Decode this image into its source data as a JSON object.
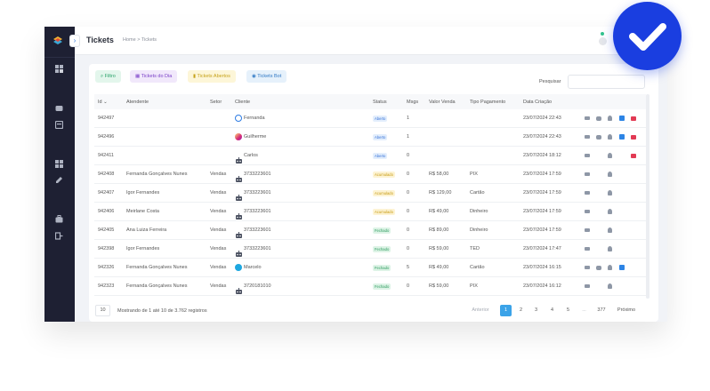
{
  "header": {
    "title": "Tickets",
    "breadcrumb": "Home  >  Tickets"
  },
  "filters": {
    "filtro": "Filtro",
    "tickets_dia": "Tickets do Dia",
    "tickets_abertos": "Tickets Abertos",
    "tickets_bot": "Tickets Bot"
  },
  "search": {
    "label": "Pesquisar",
    "value": ""
  },
  "table": {
    "columns": {
      "id": "Id",
      "atendente": "Atendente",
      "setor": "Setor",
      "cliente": "Cliente",
      "status": "Status",
      "msgs": "Msgs",
      "valor": "Valor Venda",
      "pagamento": "Tipo Pagamento",
      "data": "Data Criação"
    },
    "rows": [
      {
        "id": "942497",
        "atendente": "",
        "setor": "",
        "cliente": "Fernanda",
        "channel": "blue-ring",
        "status": "Aberto",
        "status_type": "aberto",
        "msgs": "1",
        "valor": "",
        "pagamento": "",
        "data": "23/07/2024 22:43",
        "actions": [
          "mail",
          "chat",
          "user",
          "blue",
          "red"
        ]
      },
      {
        "id": "942496",
        "atendente": "",
        "setor": "",
        "cliente": "Guilherme",
        "channel": "instagram",
        "status": "Aberto",
        "status_type": "aberto",
        "msgs": "1",
        "valor": "",
        "pagamento": "",
        "data": "23/07/2024 22:43",
        "actions": [
          "mail",
          "chat",
          "user",
          "blue",
          "red"
        ]
      },
      {
        "id": "942411",
        "atendente": "",
        "setor": "",
        "cliente": "Carlos",
        "channel": "robot",
        "status": "Aberto",
        "status_type": "aberto",
        "msgs": "0",
        "valor": "",
        "pagamento": "",
        "data": "23/07/2024 18:12",
        "actions": [
          "mail",
          "user",
          "red"
        ]
      },
      {
        "id": "942408",
        "atendente": "Fernanda Gonçalves Nunes",
        "setor": "Vendas",
        "cliente": "3733223601",
        "channel": "robot",
        "status": "Acumulado",
        "status_type": "acumulado",
        "msgs": "0",
        "valor": "R$ 58,00",
        "pagamento": "PIX",
        "data": "23/07/2024 17:59",
        "actions": [
          "mail",
          "user"
        ]
      },
      {
        "id": "942407",
        "atendente": "Igor Fernandes",
        "setor": "Vendas",
        "cliente": "3733223601",
        "channel": "robot",
        "status": "Acumulado",
        "status_type": "acumulado",
        "msgs": "0",
        "valor": "R$ 129,00",
        "pagamento": "Cartão",
        "data": "23/07/2024 17:59",
        "actions": [
          "mail",
          "user"
        ]
      },
      {
        "id": "942406",
        "atendente": "Meirlane Costa",
        "setor": "Vendas",
        "cliente": "3733223601",
        "channel": "robot",
        "status": "Acumulado",
        "status_type": "acumulado",
        "msgs": "0",
        "valor": "R$ 49,00",
        "pagamento": "Dinheiro",
        "data": "23/07/2024 17:59",
        "actions": [
          "mail",
          "user"
        ]
      },
      {
        "id": "942405",
        "atendente": "Ana Luiza Ferreira",
        "setor": "Vendas",
        "cliente": "3733223601",
        "channel": "robot",
        "status": "Fechado",
        "status_type": "fechado",
        "msgs": "0",
        "valor": "R$ 89,00",
        "pagamento": "Dinheiro",
        "data": "23/07/2024 17:59",
        "actions": [
          "mail",
          "user"
        ]
      },
      {
        "id": "942398",
        "atendente": "Igor Fernandes",
        "setor": "Vendas",
        "cliente": "3733223601",
        "channel": "robot",
        "status": "Fechado",
        "status_type": "fechado",
        "msgs": "0",
        "valor": "R$ 59,00",
        "pagamento": "TED",
        "data": "23/07/2024 17:47",
        "actions": [
          "mail",
          "user"
        ]
      },
      {
        "id": "942326",
        "atendente": "Fernanda Gonçalves Nunes",
        "setor": "Vendas",
        "cliente": "Marcelo",
        "channel": "whatsapp",
        "status": "Fechado",
        "status_type": "fechado",
        "msgs": "5",
        "valor": "R$ 49,00",
        "pagamento": "Cartão",
        "data": "23/07/2024 16:15",
        "actions": [
          "mail",
          "chat",
          "user",
          "blue"
        ]
      },
      {
        "id": "942323",
        "atendente": "Fernanda Gonçalves Nunes",
        "setor": "Vendas",
        "cliente": "3720181010",
        "channel": "robot",
        "status": "Fechado",
        "status_type": "fechado",
        "msgs": "0",
        "valor": "R$ 59,00",
        "pagamento": "PIX",
        "data": "23/07/2024 16:12",
        "actions": [
          "mail",
          "user"
        ]
      }
    ]
  },
  "footer": {
    "page_size": "10",
    "info": "Mostrando de 1 até 10 de 3.762 registros"
  },
  "pagination": {
    "prev": "Anterior",
    "pages": [
      "1",
      "2",
      "3",
      "4",
      "5",
      "...",
      "377"
    ],
    "active": "1",
    "next": "Próximo"
  },
  "icons": {
    "sort": "chevron-down-icon",
    "check": "checkmark-icon",
    "collapse": "chevron-right-icon"
  },
  "colors": {
    "sidebar": "#1e2033",
    "accent": "#3ba3e8",
    "check_badge": "#1a3ee0"
  }
}
